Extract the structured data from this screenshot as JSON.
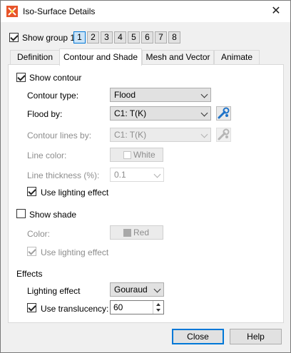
{
  "window": {
    "title": "Iso-Surface Details",
    "close_glyph": "✕"
  },
  "group": {
    "show_label": "Show group 1",
    "show_checked": true,
    "numbers": [
      "1",
      "2",
      "3",
      "4",
      "5",
      "6",
      "7",
      "8"
    ],
    "selected": "1"
  },
  "tabs": [
    {
      "label": "Definition",
      "active": false
    },
    {
      "label": "Contour and Shade",
      "active": true
    },
    {
      "label": "Mesh and Vector",
      "active": false
    },
    {
      "label": "Animate",
      "active": false
    }
  ],
  "contour": {
    "show_label": "Show contour",
    "show_checked": true,
    "type_label": "Contour type:",
    "type_value": "Flood",
    "flood_label": "Flood by:",
    "flood_value": "C1: T(K)",
    "lines_label": "Contour lines by:",
    "lines_value": "C1: T(K)",
    "line_color_label": "Line color:",
    "line_color_value": "White",
    "line_color_swatch": "#ffffff",
    "thickness_label": "Line thickness (%):",
    "thickness_value": "0.1",
    "lighting_label": "Use lighting effect",
    "lighting_checked": true
  },
  "shade": {
    "show_label": "Show shade",
    "show_checked": false,
    "color_label": "Color:",
    "color_value": "Red",
    "color_swatch": "#a8a8a8",
    "lighting_label": "Use lighting effect",
    "lighting_checked": true
  },
  "effects": {
    "heading": "Effects",
    "lighting_label": "Lighting effect",
    "lighting_value": "Gouraud",
    "translucency_label": "Use translucency:",
    "translucency_checked": true,
    "translucency_value": "60"
  },
  "buttons": {
    "close": "Close",
    "help": "Help"
  },
  "colors": {
    "accent": "#0078d7",
    "icon_blue": "#1f73c8",
    "icon_gray": "#a0a0a0"
  }
}
